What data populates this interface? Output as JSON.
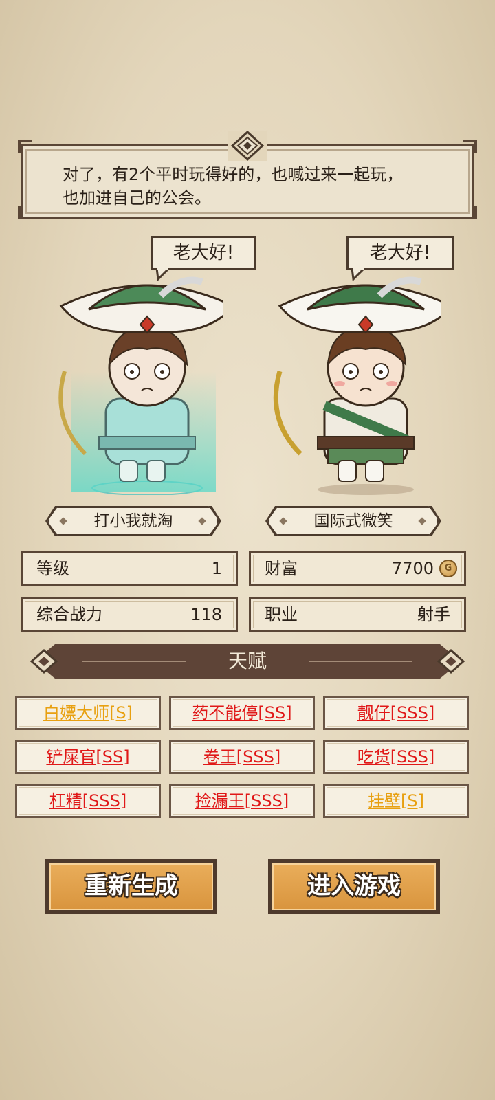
{
  "dialog": {
    "line1": "对了，有2个平时玩得好的，也喊过来一起玩，",
    "line2": "也加进自己的公会。"
  },
  "characters": [
    {
      "speech": "老大好!",
      "name": "打小我就淘",
      "effect": "ghost-glow",
      "stats": {
        "level_label": "等级",
        "level": "1",
        "power_label": "综合战力",
        "power": "118"
      }
    },
    {
      "speech": "老大好!",
      "name": "国际式微笑",
      "effect": "normal",
      "stats": {
        "wealth_label": "财富",
        "wealth": "7700",
        "job_label": "职业",
        "job": "射手",
        "coin_icon": "coin-icon"
      }
    }
  ],
  "talent": {
    "title": "天赋",
    "items": [
      {
        "text": "白嫖大师[S]",
        "rank": "S"
      },
      {
        "text": "药不能停[SS]",
        "rank": "SS"
      },
      {
        "text": "靓仔[SSS]",
        "rank": "SSS"
      },
      {
        "text": "铲屎官[SS]",
        "rank": "SS"
      },
      {
        "text": "卷王[SSS]",
        "rank": "SSS"
      },
      {
        "text": "吃货[SSS]",
        "rank": "SSS"
      },
      {
        "text": "杠精[SSS]",
        "rank": "SSS"
      },
      {
        "text": "捡漏王[SSS]",
        "rank": "SSS"
      },
      {
        "text": "挂壁[S]",
        "rank": "S"
      }
    ]
  },
  "buttons": {
    "regenerate": "重新生成",
    "enter": "进入游戏"
  },
  "colors": {
    "rank_s": "#e8a010",
    "rank_high": "#e01818",
    "button": "#e0a04a",
    "banner": "#5e4437"
  }
}
